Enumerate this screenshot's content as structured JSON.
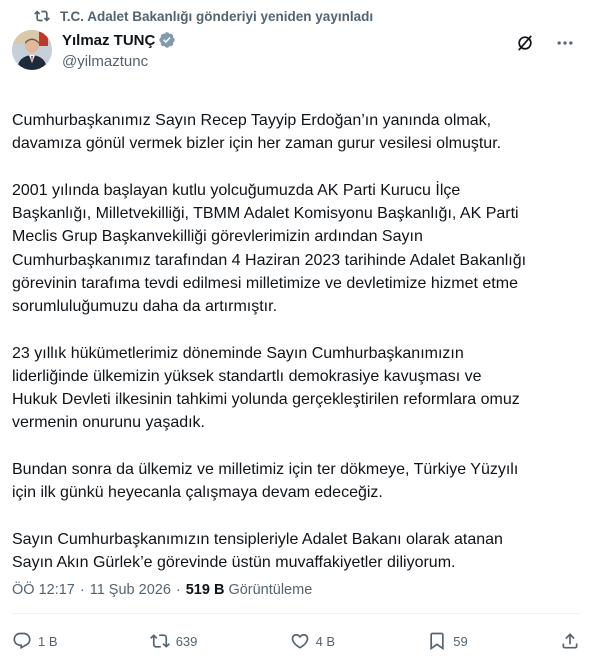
{
  "repost": {
    "icon": "repost-icon",
    "text": "T.C. Adalet Bakanlığı gönderiyi yeniden yayınladı"
  },
  "author": {
    "display_name": "Yılmaz TUNÇ",
    "handle": "@yilmaztunc",
    "verified_icon": "verified-badge-icon",
    "verified_color": "#829aab"
  },
  "top_actions": {
    "grok_icon": "grok-icon",
    "more_icon": "more-icon"
  },
  "tweet": {
    "paragraphs": [
      "Cumhurbaşkanımız Sayın Recep Tayyip Erdoğan’ın yanında olmak,\ndavamıza gönül vermek bizler için her zaman gurur vesilesi olmuştur.",
      "2001 yılında başlayan kutlu yolcuğumuzda AK Parti Kurucu İlçe\nBaşkanlığı, Milletvekilliği, TBMM Adalet Komisyonu Başkanlığı, AK Parti\nMeclis Grup Başkanvekilliği görevlerimizin ardından Sayın\nCumhurbaşkanımız tarafından 4 Haziran 2023 tarihinde Adalet Bakanlığı\ngörevinin tarafıma tevdi edilmesi milletimize ve devletimize hizmet etme\nsorumluluğumuzu daha da artırmıştır.",
      "23 yıllık hükümetlerimiz döneminde Sayın Cumhurbaşkanımızın\nliderliğinde ülkemizin yüksek standartlı demokrasiye kavuşması ve\nHukuk Devleti ilkesinin tahkimi yolunda gerçekleştirilen reformlara omuz\nvermenin onurunu yaşadık.",
      "Bundan sonra da ülkemiz ve milletimiz için ter dökmeye, Türkiye Yüzyılı\niçin ilk günkü heyecanla çalışmaya devam edeceğiz.",
      "Sayın Cumhurbaşkanımızın tensipleriyle Adalet Bakanı olarak atanan\nSayın Akın Gürlek’e görevinde üstün muvaffakiyetler diliyorum."
    ]
  },
  "meta": {
    "time": "ÖÖ 12:17",
    "separator": "·",
    "date": "11 Şub 2026",
    "views_count": "519 B",
    "views_label": "Görüntüleme"
  },
  "actions": {
    "reply": {
      "icon": "reply-icon",
      "count": "1 B"
    },
    "repost": {
      "icon": "repost-icon",
      "count": "639"
    },
    "like": {
      "icon": "heart-icon",
      "count": "4 B"
    },
    "bookmark": {
      "icon": "bookmark-icon",
      "count": "59"
    },
    "share": {
      "icon": "share-icon"
    }
  },
  "colors": {
    "text_primary": "#0f1419",
    "text_secondary": "#536471",
    "divider": "#eff3f4"
  }
}
